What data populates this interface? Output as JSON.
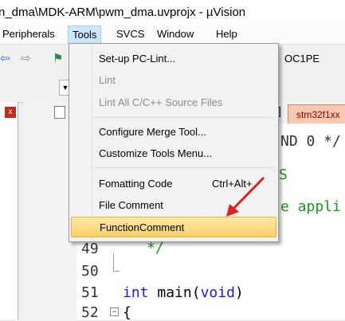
{
  "window": {
    "title": "n_dma\\MDK-ARM\\pwm_dma.uvprojx - µVision"
  },
  "menubar": {
    "items": [
      "Peripherals",
      "Tools",
      "SVCS",
      "Window",
      "Help"
    ]
  },
  "toolbar": {
    "combo_value": "OC1PE"
  },
  "tabs": {
    "file_tab": "stm32f1xx"
  },
  "tools_menu": {
    "items": [
      {
        "label": "Set-up PC-Lint...",
        "enabled": true
      },
      {
        "label": "Lint",
        "enabled": false
      },
      {
        "label": "Lint All C/C++ Source Files",
        "enabled": false
      },
      {
        "label": "Configure Merge Tool...",
        "enabled": true
      },
      {
        "label": "Customize Tools Menu...",
        "enabled": true
      },
      {
        "label": "Fomatting Code",
        "shortcut": "Ctrl+Alt+",
        "enabled": true
      },
      {
        "label": "File Comment",
        "enabled": true
      },
      {
        "label": "FunctionComment",
        "enabled": true,
        "highlighted": true
      }
    ]
  },
  "editor": {
    "line_numbers": [
      "49",
      "50",
      "51",
      "52"
    ],
    "fragments": {
      "line1": "ND 0 */",
      "line2": "S",
      "line3": "e appli",
      "line4": "*/",
      "keyword_int": "int",
      "func_main": "main",
      "paren_open": "(",
      "keyword_void": "void",
      "paren_close": ")",
      "brace": "{"
    }
  },
  "colors": {
    "menu_highlight": "#f9cf6a",
    "tab_active": "#f8c8b0",
    "annotation_arrow": "#e02020",
    "keyword": "#1a1ae6",
    "comment": "#1a9a1a"
  }
}
